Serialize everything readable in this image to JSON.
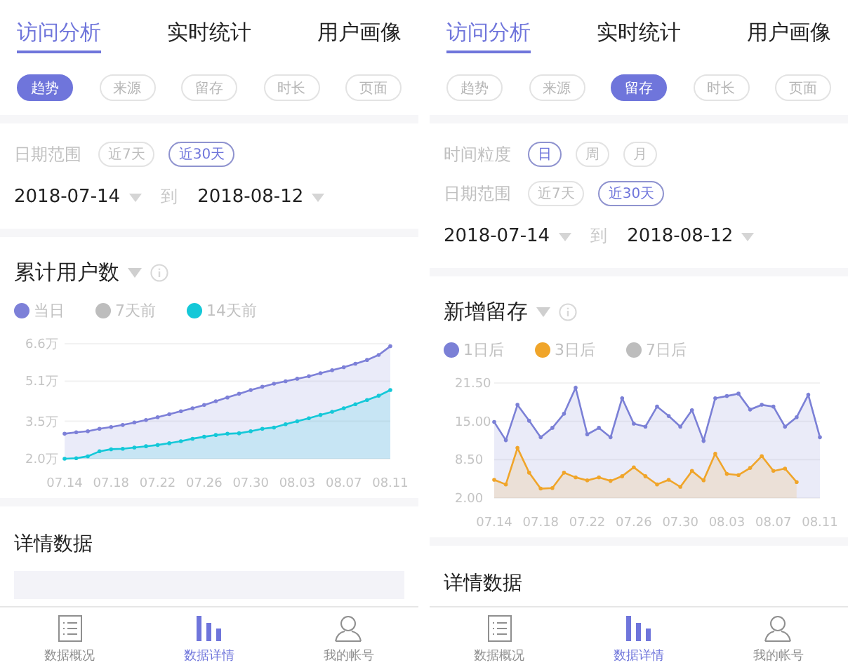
{
  "screens": [
    {
      "tabs": [
        {
          "label": "访问分析",
          "selected": true
        },
        {
          "label": "实时统计",
          "selected": false
        },
        {
          "label": "用户画像",
          "selected": false
        }
      ],
      "chips": [
        {
          "label": "趋势",
          "selected": true
        },
        {
          "label": "来源",
          "selected": false
        },
        {
          "label": "留存",
          "selected": false
        },
        {
          "label": "时长",
          "selected": false
        },
        {
          "label": "页面",
          "selected": false
        }
      ],
      "filters": [
        {
          "label": "日期范围",
          "options": [
            {
              "label": "近7天",
              "selected": false
            },
            {
              "label": "近30天",
              "selected": true
            }
          ]
        }
      ],
      "date_range": {
        "start": "2018-07-14",
        "separator": "到",
        "end": "2018-08-12"
      },
      "chart_card": {
        "title": "累计用户数",
        "chart_data": {
          "type": "area",
          "categories": [
            "07.14",
            null,
            null,
            null,
            "07.18",
            null,
            null,
            null,
            "07.22",
            null,
            null,
            null,
            "07.26",
            null,
            null,
            null,
            "07.30",
            null,
            null,
            null,
            "08.03",
            null,
            null,
            null,
            "08.07",
            null,
            null,
            null,
            "08.11"
          ],
          "series": [
            {
              "name": "当日",
              "color": "#7d80d8",
              "values": [
                3.0,
                3.06,
                3.1,
                3.2,
                3.27,
                3.35,
                3.45,
                3.55,
                3.66,
                3.78,
                3.9,
                4.02,
                4.15,
                4.3,
                4.45,
                4.6,
                4.75,
                4.88,
                5.0,
                5.1,
                5.2,
                5.3,
                5.42,
                5.54,
                5.66,
                5.8,
                5.95,
                6.15,
                6.5
              ]
            },
            {
              "name": "7天前",
              "color": "#bdbdbd",
              "values": [
                null,
                null,
                null,
                null,
                null,
                null,
                null,
                null,
                null,
                null,
                null,
                null,
                null,
                null,
                null,
                null,
                null,
                null,
                null,
                null,
                null,
                null,
                null,
                null,
                null,
                null,
                null,
                null,
                null
              ]
            },
            {
              "name": "14天前",
              "color": "#14c8d8",
              "values": [
                2.0,
                2.02,
                2.1,
                2.3,
                2.38,
                2.4,
                2.45,
                2.5,
                2.55,
                2.62,
                2.7,
                2.8,
                2.88,
                2.95,
                3.0,
                3.02,
                3.1,
                3.2,
                3.25,
                3.38,
                3.5,
                3.62,
                3.75,
                3.88,
                4.02,
                4.18,
                4.35,
                4.52,
                4.75
              ]
            }
          ],
          "ylim": [
            2.0,
            6.6
          ],
          "yticks": [
            {
              "value": 2.0,
              "label": "2.0万"
            },
            {
              "value": 3.5,
              "label": "3.5万"
            },
            {
              "value": 5.1,
              "label": "5.1万"
            },
            {
              "value": 6.6,
              "label": "6.6万"
            }
          ]
        }
      },
      "details_title": "详情数据",
      "details_table_peek": true,
      "bottom_nav": [
        {
          "label": "数据概况",
          "selected": false
        },
        {
          "label": "数据详情",
          "selected": true
        },
        {
          "label": "我的帐号",
          "selected": false
        }
      ]
    },
    {
      "tabs": [
        {
          "label": "访问分析",
          "selected": true
        },
        {
          "label": "实时统计",
          "selected": false
        },
        {
          "label": "用户画像",
          "selected": false
        }
      ],
      "chips": [
        {
          "label": "趋势",
          "selected": false
        },
        {
          "label": "来源",
          "selected": false
        },
        {
          "label": "留存",
          "selected": true
        },
        {
          "label": "时长",
          "selected": false
        },
        {
          "label": "页面",
          "selected": false
        }
      ],
      "filters": [
        {
          "label": "时间粒度",
          "options": [
            {
              "label": "日",
              "selected": true
            },
            {
              "label": "周",
              "selected": false
            },
            {
              "label": "月",
              "selected": false
            }
          ]
        },
        {
          "label": "日期范围",
          "options": [
            {
              "label": "近7天",
              "selected": false
            },
            {
              "label": "近30天",
              "selected": true
            }
          ]
        }
      ],
      "date_range": {
        "start": "2018-07-14",
        "separator": "到",
        "end": "2018-08-12"
      },
      "chart_card": {
        "title": "新增留存",
        "chart_data": {
          "type": "area",
          "categories": [
            "07.14",
            null,
            null,
            null,
            "07.18",
            null,
            null,
            null,
            "07.22",
            null,
            null,
            null,
            "07.26",
            null,
            null,
            null,
            "07.30",
            null,
            null,
            null,
            "08.03",
            null,
            null,
            null,
            "08.07",
            null,
            null,
            null,
            "08.11"
          ],
          "series": [
            {
              "name": "1日后",
              "color": "#7b80d6",
              "values": [
                14.9,
                11.8,
                17.8,
                15.1,
                12.3,
                13.9,
                16.3,
                20.7,
                12.8,
                13.9,
                12.3,
                18.9,
                14.6,
                14.1,
                17.5,
                15.9,
                14.1,
                16.9,
                11.7,
                18.9,
                19.3,
                19.7,
                17.0,
                17.8,
                17.5,
                14.1,
                15.7,
                19.5,
                12.3
              ]
            },
            {
              "name": "3日后",
              "color": "#f0a52a",
              "values": [
                5.1,
                4.3,
                10.5,
                6.3,
                3.6,
                3.7,
                6.3,
                5.5,
                5.0,
                5.5,
                4.9,
                5.7,
                7.2,
                5.7,
                4.3,
                5.1,
                3.9,
                6.6,
                5.0,
                9.5,
                6.1,
                5.9,
                7.1,
                9.1,
                6.6,
                7.0,
                4.7,
                null,
                null
              ]
            },
            {
              "name": "7日后",
              "color": "#bdbdbd",
              "values": [
                null,
                null,
                null,
                null,
                null,
                null,
                null,
                null,
                null,
                null,
                null,
                null,
                null,
                null,
                null,
                null,
                null,
                null,
                null,
                null,
                null,
                null,
                null,
                null,
                null,
                null,
                null,
                null,
                null
              ]
            }
          ],
          "ylim": [
            2.0,
            21.5
          ],
          "yticks": [
            {
              "value": 2.0,
              "label": "2.00"
            },
            {
              "value": 8.5,
              "label": "8.50"
            },
            {
              "value": 15.0,
              "label": "15.00"
            },
            {
              "value": 21.5,
              "label": "21.50"
            }
          ]
        }
      },
      "details_title": "详情数据",
      "details_table_peek": false,
      "bottom_nav": [
        {
          "label": "数据概况",
          "selected": false
        },
        {
          "label": "数据详情",
          "selected": true
        },
        {
          "label": "我的帐号",
          "selected": false
        }
      ]
    }
  ]
}
